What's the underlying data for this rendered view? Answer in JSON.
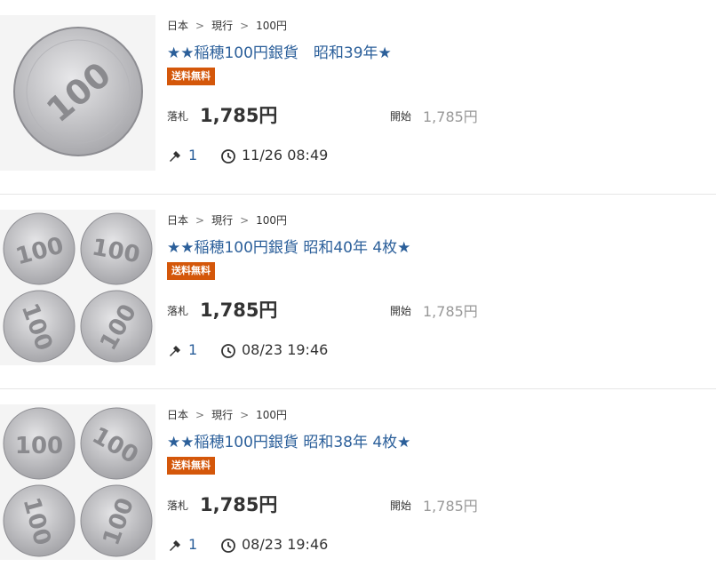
{
  "items": [
    {
      "breadcrumb": [
        "日本",
        "現行",
        "100円"
      ],
      "title": "★★稲穂100円銀貨　昭和39年★",
      "badge": "送料無料",
      "price_label": "落札",
      "price": "1,785円",
      "start_label": "開始",
      "start_price": "1,785円",
      "bids": "1",
      "time": "11/26 08:49",
      "thumb_icon": "single-coin-image"
    },
    {
      "breadcrumb": [
        "日本",
        "現行",
        "100円"
      ],
      "title": "★★稲穂100円銀貨 昭和40年 4枚★",
      "badge": "送料無料",
      "price_label": "落札",
      "price": "1,785円",
      "start_label": "開始",
      "start_price": "1,785円",
      "bids": "1",
      "time": "08/23 19:46",
      "thumb_icon": "four-coins-image"
    },
    {
      "breadcrumb": [
        "日本",
        "現行",
        "100円"
      ],
      "title": "★★稲穂100円銀貨 昭和38年 4枚★",
      "badge": "送料無料",
      "price_label": "落札",
      "price": "1,785円",
      "start_label": "開始",
      "start_price": "1,785円",
      "bids": "1",
      "time": "08/23 19:46",
      "thumb_icon": "four-coins-image"
    }
  ],
  "separator": ">",
  "coin_face_text": "100",
  "colors": {
    "link": "#2b5f9a",
    "badge_bg": "#d4570a",
    "muted_price": "#999999",
    "coin_silver": "#c9c9cb"
  }
}
